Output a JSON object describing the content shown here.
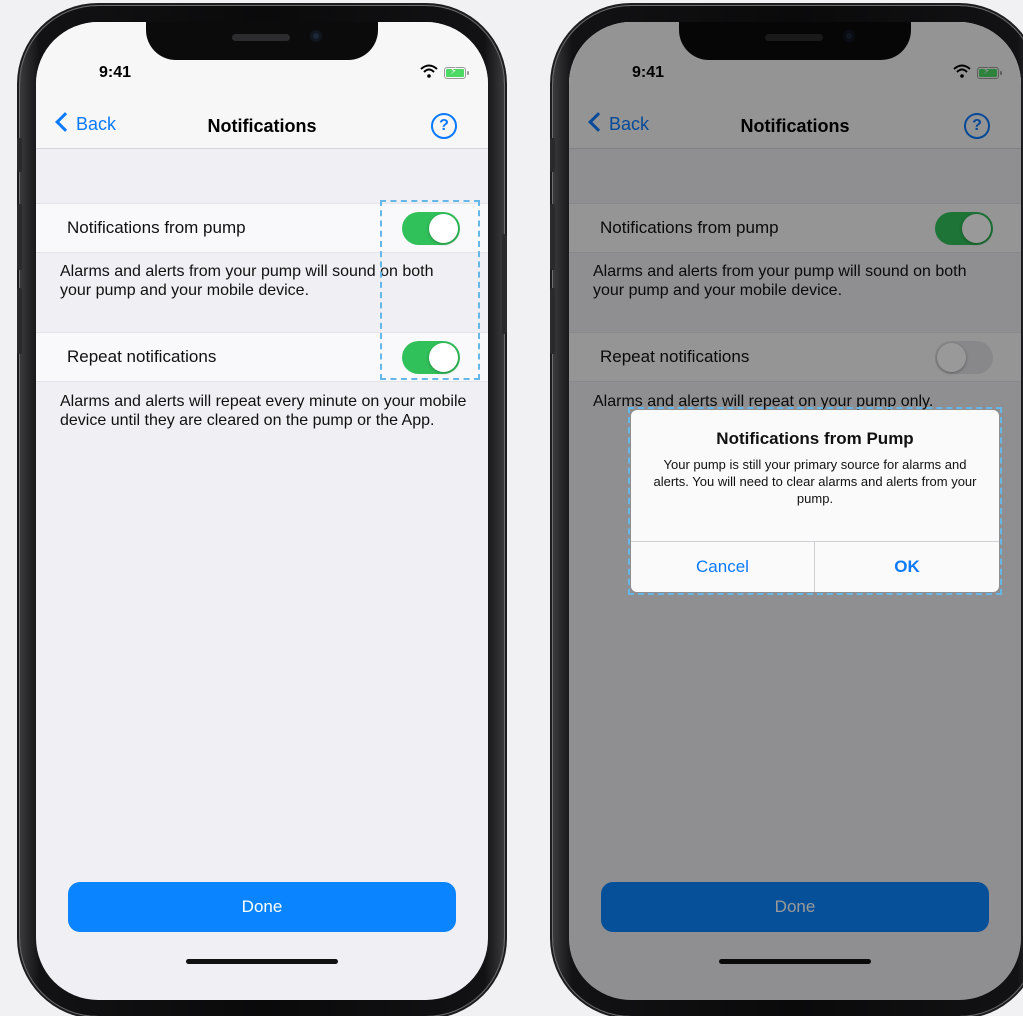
{
  "status_bar": {
    "time": "9:41"
  },
  "nav": {
    "back_label": "Back",
    "title": "Notifications",
    "help_label": "?"
  },
  "left_screen": {
    "rows": [
      {
        "label": "Notifications from pump",
        "toggle_on": true
      },
      {
        "label": "Repeat notifications",
        "toggle_on": true
      }
    ],
    "desc_pump": "Alarms and alerts from your pump will sound on both your pump and your mobile device.",
    "desc_repeat": "Alarms and alerts will repeat every minute on your mobile device until they are cleared on the pump or the App."
  },
  "right_screen": {
    "rows": [
      {
        "label": "Notifications from pump",
        "toggle_on": true
      },
      {
        "label": "Repeat notifications",
        "toggle_on": false
      }
    ],
    "desc_pump": "Alarms and alerts from your pump will sound on both your pump and your mobile device.",
    "desc_repeat": "Alarms and alerts will repeat on your pump only.",
    "alert": {
      "title": "Notifications from Pump",
      "message": "Your pump is still your primary source for alarms and alerts. You will need to clear alarms and alerts from your pump.",
      "cancel_label": "Cancel",
      "ok_label": "OK"
    }
  },
  "done_label": "Done",
  "colors": {
    "accent": "#0a7aff",
    "toggle_on": "#31c15a",
    "button": "#0a84ff",
    "highlight": "#65b7e8"
  }
}
